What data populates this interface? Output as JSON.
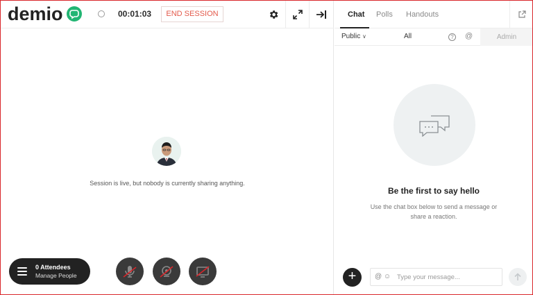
{
  "brand": {
    "name": "demio",
    "accent": "#22b573"
  },
  "header": {
    "timer": "00:01:03",
    "end_session_label": "END SESSION",
    "icons": [
      "gear-icon",
      "expand-icon",
      "collapse-panel-icon"
    ]
  },
  "stage": {
    "status_message": "Session is live, but nobody is currently sharing anything."
  },
  "attendees": {
    "count_label": "0 Attendees",
    "manage_label": "Manage People"
  },
  "controls": [
    "mic-off-icon",
    "camera-off-icon",
    "screen-share-off-icon"
  ],
  "sidebar": {
    "tabs": [
      {
        "label": "Chat",
        "active": true
      },
      {
        "label": "Polls",
        "active": false
      },
      {
        "label": "Handouts",
        "active": false
      }
    ],
    "filter": {
      "visibility": "Public",
      "audience": "All",
      "role": "Admin"
    },
    "empty_title": "Be the first to say hello",
    "empty_hint": "Use the chat box below to send a message or share a reaction.",
    "input_placeholder": "Type your message..."
  },
  "colors": {
    "end_session": "#e35a4b",
    "dark": "#222222"
  }
}
